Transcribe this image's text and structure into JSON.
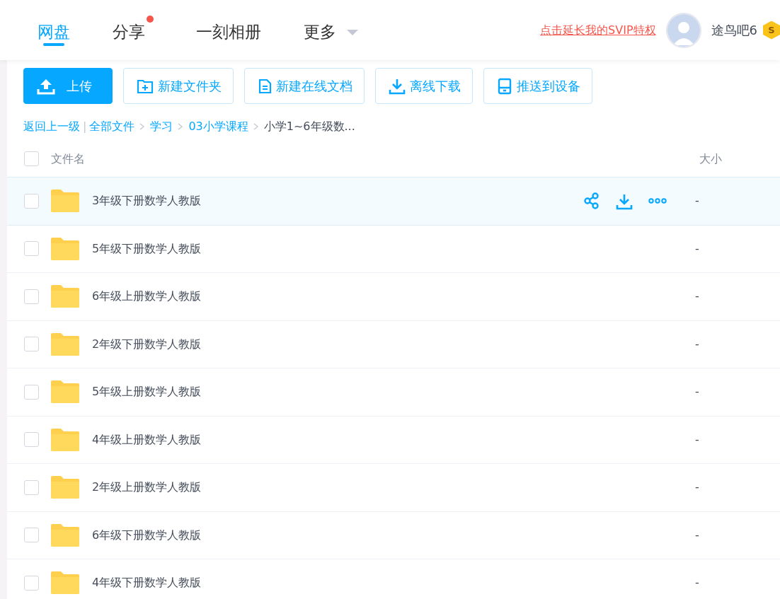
{
  "nav": {
    "tabs": [
      {
        "label": "网盘",
        "selected": true,
        "dot": false,
        "caret": false
      },
      {
        "label": "分享",
        "selected": false,
        "dot": true,
        "caret": false
      },
      {
        "label": "一刻相册",
        "selected": false,
        "dot": false,
        "caret": false
      },
      {
        "label": "更多",
        "selected": false,
        "dot": false,
        "caret": true
      }
    ],
    "promo_link": "点击延长我的SVIP特权",
    "username": "途鸟吧6",
    "vip_badge": "S"
  },
  "toolbar": [
    {
      "label": "上传",
      "kind": "upload",
      "primary": true
    },
    {
      "label": "新建文件夹",
      "kind": "folder",
      "primary": false
    },
    {
      "label": "新建在线文档",
      "kind": "doc",
      "primary": false
    },
    {
      "label": "离线下载",
      "kind": "download",
      "primary": false
    },
    {
      "label": "推送到设备",
      "kind": "device",
      "primary": false
    }
  ],
  "breadcrumb": {
    "back": "返回上一级",
    "separator": "|",
    "path": [
      "全部文件",
      "学习",
      "03小学课程"
    ],
    "current": "小学1~6年级数..."
  },
  "table": {
    "columns": [
      "文件名",
      "大小"
    ],
    "select_all_checked": false,
    "rows": [
      {
        "name": "3年级下册数学人教版",
        "size": "-",
        "checked": false,
        "hovered": true
      },
      {
        "name": "5年级下册数学人教版",
        "size": "-",
        "checked": false,
        "hovered": false
      },
      {
        "name": "6年级上册数学人教版",
        "size": "-",
        "checked": false,
        "hovered": false
      },
      {
        "name": "2年级下册数学人教版",
        "size": "-",
        "checked": false,
        "hovered": false
      },
      {
        "name": "5年级上册数学人教版",
        "size": "-",
        "checked": false,
        "hovered": false
      },
      {
        "name": "4年级上册数学人教版",
        "size": "-",
        "checked": false,
        "hovered": false
      },
      {
        "name": "2年级上册数学人教版",
        "size": "-",
        "checked": false,
        "hovered": false
      },
      {
        "name": "6年级下册数学人教版",
        "size": "-",
        "checked": false,
        "hovered": false
      },
      {
        "name": "4年级下册数学人教版",
        "size": "-",
        "checked": false,
        "hovered": false
      }
    ]
  }
}
